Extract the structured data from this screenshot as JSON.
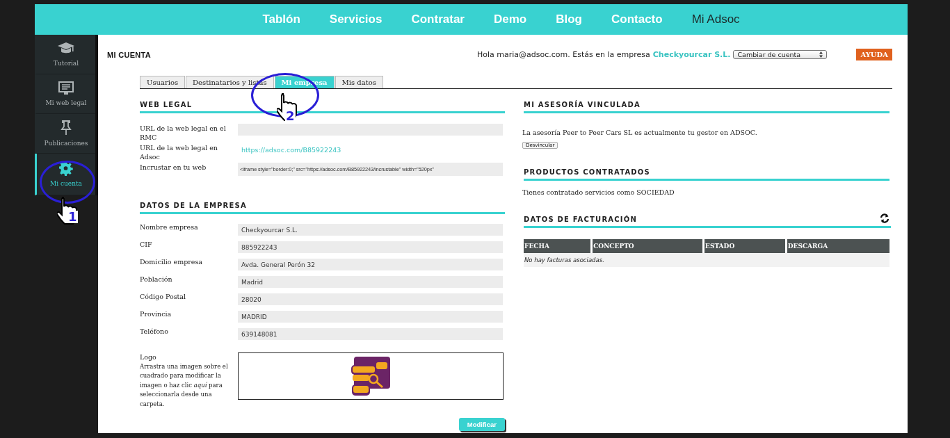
{
  "nav": {
    "items": [
      {
        "label": "Tablón",
        "selected": false
      },
      {
        "label": "Servicios",
        "selected": false
      },
      {
        "label": "Contratar",
        "selected": false
      },
      {
        "label": "Demo",
        "selected": false
      },
      {
        "label": "Blog",
        "selected": false
      },
      {
        "label": "Contacto",
        "selected": false
      },
      {
        "label": "Mi Adsoc",
        "selected": true
      }
    ]
  },
  "sidebar": {
    "items": [
      {
        "label": "Tutorial",
        "selected": false
      },
      {
        "label": "Mi web legal",
        "selected": false
      },
      {
        "label": "Publicaciones",
        "selected": false
      },
      {
        "label": "Mi cuenta",
        "selected": true
      }
    ]
  },
  "page_title": "MI CUENTA",
  "greeting": {
    "text": "Hola maria@adsoc.com. Estás en la empresa",
    "company": "Checkyourcar S.L.",
    "account_select": "Cambiar de cuenta"
  },
  "help_button": "AYUDA",
  "tabs": [
    {
      "label": "Usuarios",
      "selected": false
    },
    {
      "label": "Destinatarios y listas",
      "selected": false
    },
    {
      "label": "Mi empresa",
      "selected": true
    },
    {
      "label": "Mis datos",
      "selected": false
    }
  ],
  "web_legal": {
    "title": "WEB LEGAL",
    "rows": [
      {
        "label": "URL de la web legal en el RMC",
        "kind": "field"
      },
      {
        "label": "URL de la web legal en Adsoc",
        "kind": "link",
        "value": "https://adsoc.com/B85922243"
      },
      {
        "label": "Incrustar en tu web",
        "kind": "textarea",
        "value": "<iframe style=\"border:0;\" src=\"https://adsoc.com/B85922243/incrustable\" width=\"520px\""
      }
    ]
  },
  "company_data": {
    "title": "DATOS DE LA EMPRESA",
    "rows": [
      {
        "label": "Nombre empresa",
        "value": "Checkyourcar S.L."
      },
      {
        "label": "CIF",
        "value": "885922243"
      },
      {
        "label": "Domicilio empresa",
        "value": "Avda. General Perón 32"
      },
      {
        "label": "Población",
        "value": "Madrid"
      },
      {
        "label": "Código Postal",
        "value": "28020"
      },
      {
        "label": "Provincia",
        "value": "MADRID"
      },
      {
        "label": "Teléfono",
        "value": "639148081"
      }
    ],
    "logo": {
      "label": "Logo",
      "hint": "Arrastra una imagen sobre el cuadrado para modificar la imagen o haz clic *aquí* para seleccionarla desde una carpeta.",
      "kind": "picture"
    },
    "button": "Modificar"
  },
  "advisory": {
    "title": "MI ASESORÍA VINCULADA",
    "text": "La asesoría Peer to Peer Cars SL es actualmente tu gestor en ADSOC.",
    "button": "Desvincular"
  },
  "products": {
    "title": "PRODUCTOS CONTRATADOS",
    "text": "Tienes contratado servicios como SOCIEDAD"
  },
  "billing": {
    "title": "DATOS DE FACTURACIÓN",
    "columns": [
      "FECHA",
      "CONCEPTO",
      "ESTADO",
      "DESCARGA"
    ],
    "empty": "No hay facturas asociadas."
  },
  "annotations": [
    {
      "number": "1"
    },
    {
      "number": "2"
    }
  ]
}
